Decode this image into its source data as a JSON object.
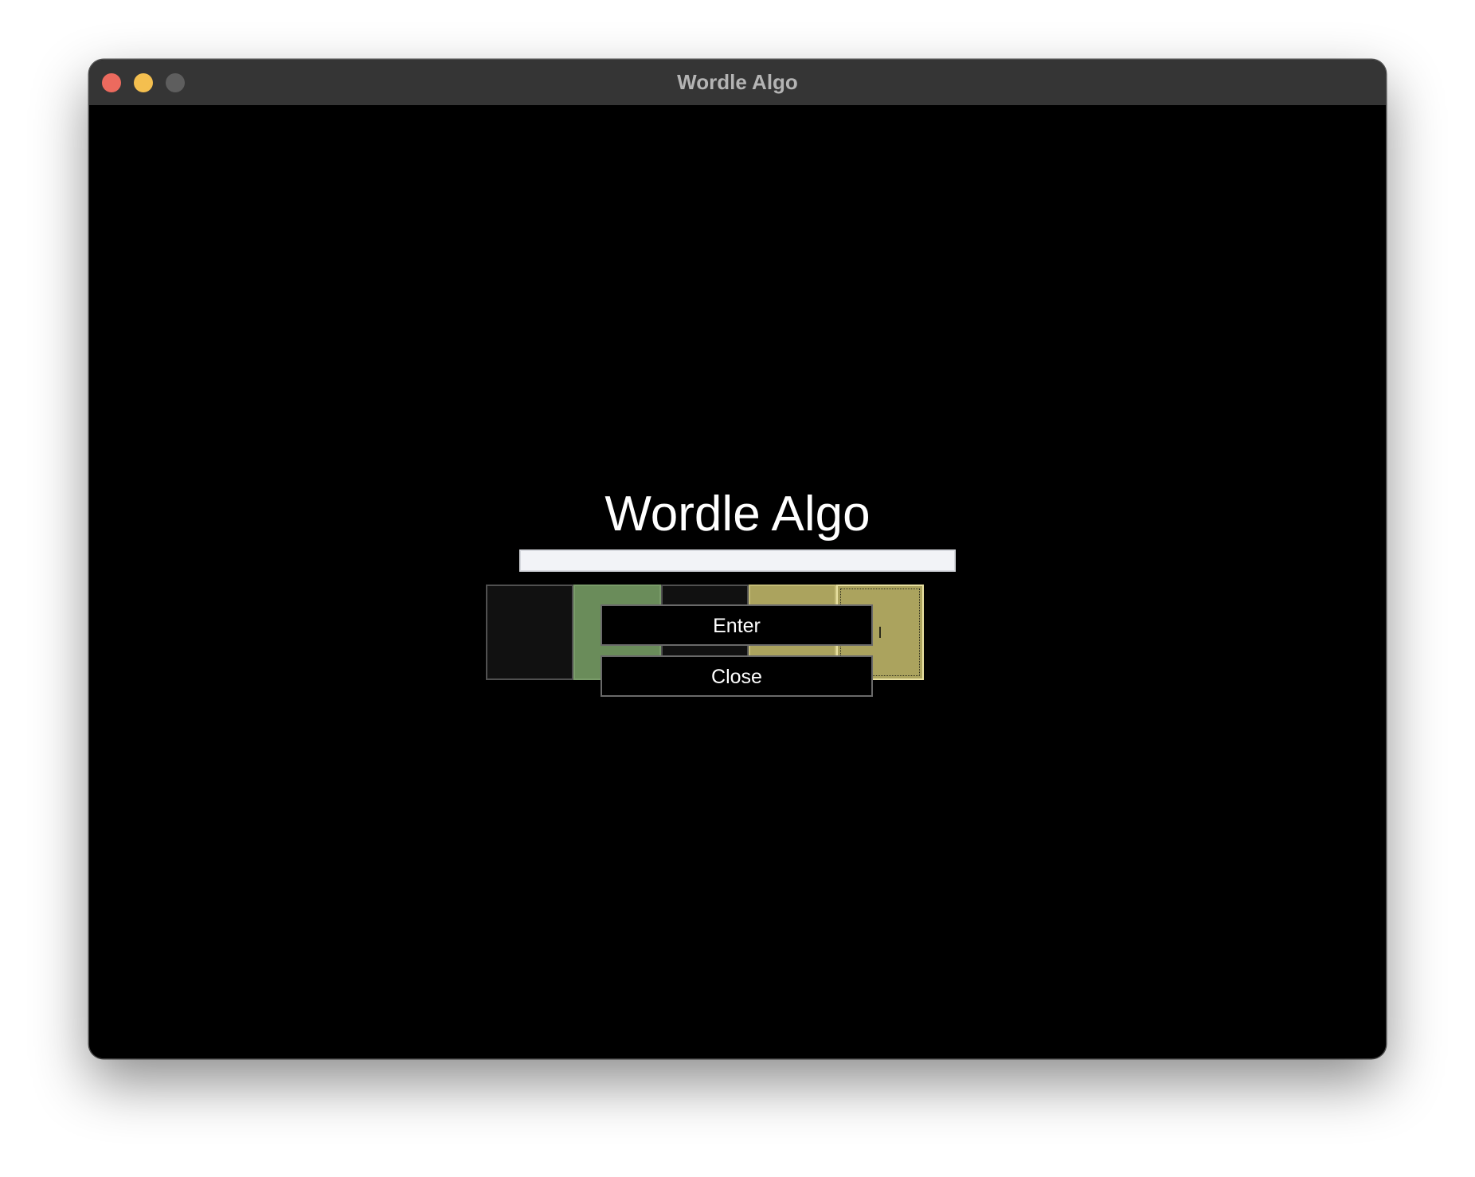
{
  "window": {
    "title": "Wordle Algo"
  },
  "app": {
    "title": "Wordle Algo",
    "input_value": "",
    "tiles": [
      {
        "state": "absent",
        "color": "#111111",
        "border": "#505050",
        "content": "empty"
      },
      {
        "state": "correct",
        "color": "#6a8c5a",
        "border": "#7a9c6a",
        "content": "dash"
      },
      {
        "state": "absent",
        "color": "#111111",
        "border": "#505050",
        "content": "empty"
      },
      {
        "state": "present",
        "color": "#aba35e",
        "border": "#c5bd78",
        "content": "cursor"
      },
      {
        "state": "present",
        "color": "#aba35e",
        "border": "#e8e0a0",
        "content": "cursor",
        "focused": true
      }
    ],
    "enter_label": "Enter",
    "close_label": "Close"
  },
  "colors": {
    "titlebar": "#353535",
    "background": "#000000",
    "close_dot": "#ec6a5e",
    "minimize_dot": "#f4bf4f",
    "zoom_dot": "#5e5e5e"
  }
}
